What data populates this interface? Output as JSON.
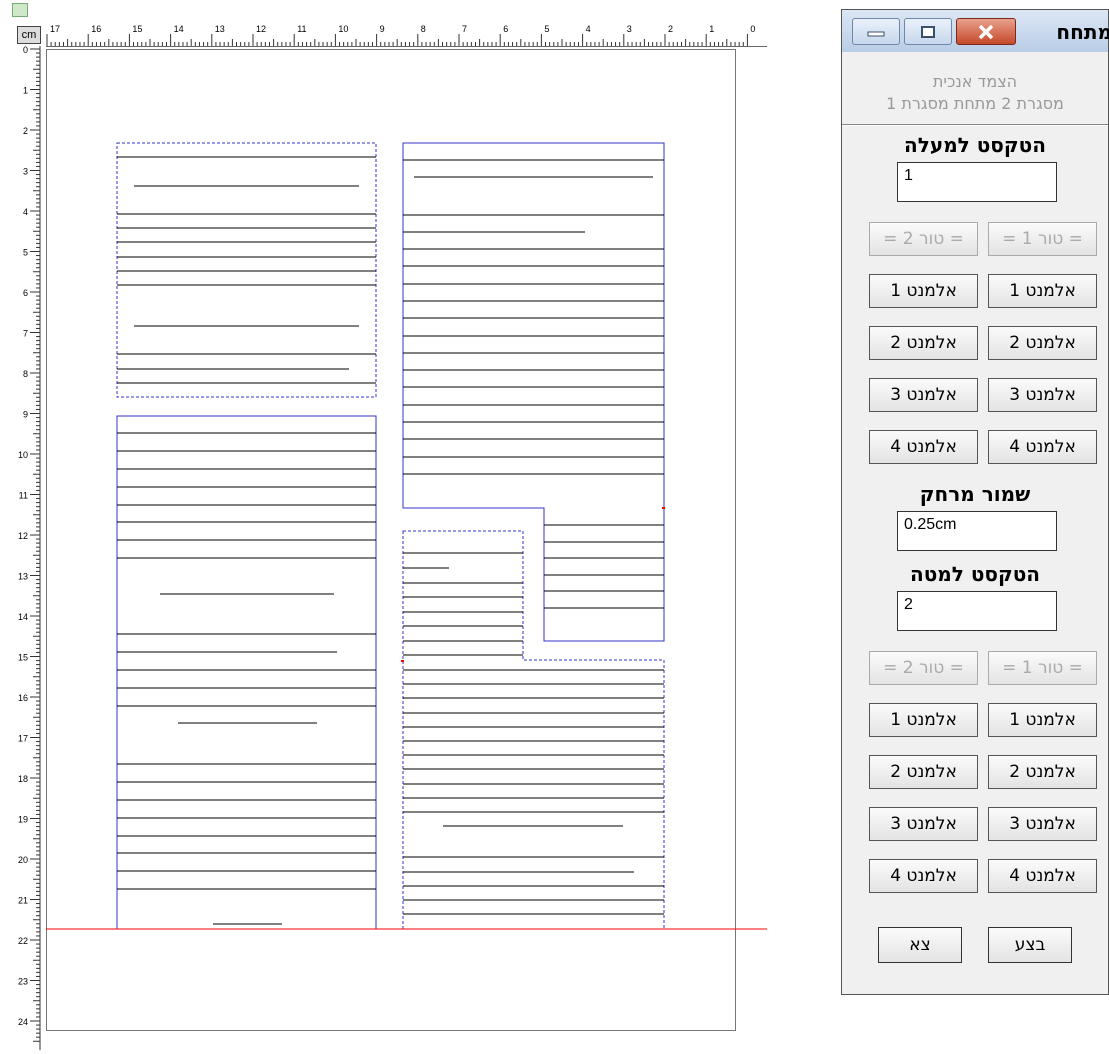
{
  "ruler": {
    "unit": "cm",
    "h_labels": [
      "17",
      "16",
      "15",
      "14",
      "13",
      "12",
      "11",
      "10",
      "9",
      "8",
      "7",
      "6",
      "5",
      "4",
      "3",
      "2",
      "1",
      "0"
    ],
    "v_labels": [
      "0",
      "1",
      "2",
      "3",
      "4",
      "5",
      "6",
      "7",
      "8",
      "9",
      "10",
      "11",
      "12",
      "13",
      "14",
      "15",
      "16",
      "17",
      "18",
      "19",
      "20",
      "21",
      "22",
      "23",
      "24"
    ]
  },
  "dialog": {
    "title": "מתחח",
    "subtitle_line1": "הצמד אנכית",
    "subtitle_line2": "מסגרת 2 מתחת מסגרת 1",
    "top_text_label": "הטקסט למעלה",
    "top_text_value": "1",
    "spacing_label": "שמור מרחק",
    "spacing_value": "0.25cm",
    "bottom_text_label": "הטקסט למטה",
    "bottom_text_value": "2",
    "col1_header": "= טור 1 =",
    "col2_header": "= טור 2 =",
    "elements": [
      "אלמנט 1",
      "אלמנט 2",
      "אלמנט 3",
      "אלמנט 4"
    ],
    "execute_button": "בצע",
    "exit_button": "צא"
  },
  "colors": {
    "frame_border": "#3333cc",
    "guide_line": "#ff0000",
    "text_line": "#000000"
  }
}
